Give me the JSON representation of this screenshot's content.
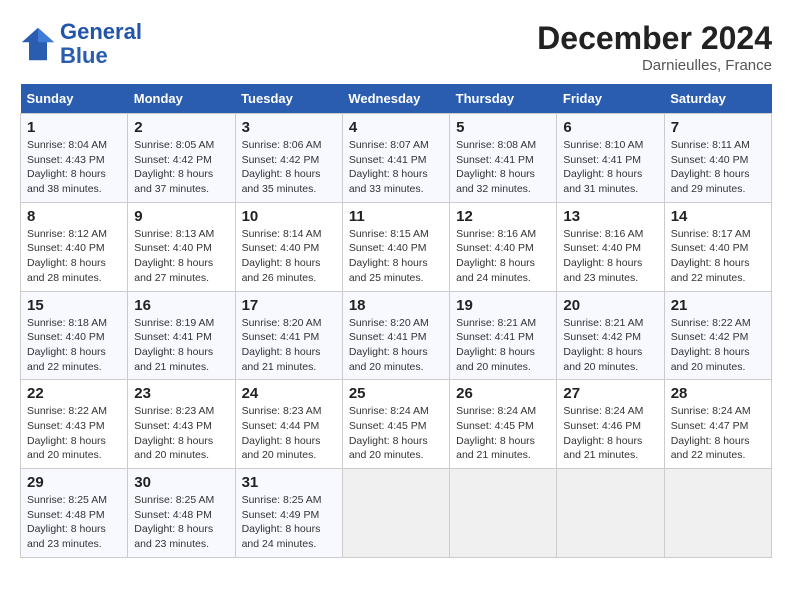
{
  "header": {
    "logo_line1": "General",
    "logo_line2": "Blue",
    "month_title": "December 2024",
    "location": "Darnieulles, France"
  },
  "weekdays": [
    "Sunday",
    "Monday",
    "Tuesday",
    "Wednesday",
    "Thursday",
    "Friday",
    "Saturday"
  ],
  "weeks": [
    [
      {
        "day": "1",
        "sunrise": "Sunrise: 8:04 AM",
        "sunset": "Sunset: 4:43 PM",
        "daylight": "Daylight: 8 hours and 38 minutes."
      },
      {
        "day": "2",
        "sunrise": "Sunrise: 8:05 AM",
        "sunset": "Sunset: 4:42 PM",
        "daylight": "Daylight: 8 hours and 37 minutes."
      },
      {
        "day": "3",
        "sunrise": "Sunrise: 8:06 AM",
        "sunset": "Sunset: 4:42 PM",
        "daylight": "Daylight: 8 hours and 35 minutes."
      },
      {
        "day": "4",
        "sunrise": "Sunrise: 8:07 AM",
        "sunset": "Sunset: 4:41 PM",
        "daylight": "Daylight: 8 hours and 33 minutes."
      },
      {
        "day": "5",
        "sunrise": "Sunrise: 8:08 AM",
        "sunset": "Sunset: 4:41 PM",
        "daylight": "Daylight: 8 hours and 32 minutes."
      },
      {
        "day": "6",
        "sunrise": "Sunrise: 8:10 AM",
        "sunset": "Sunset: 4:41 PM",
        "daylight": "Daylight: 8 hours and 31 minutes."
      },
      {
        "day": "7",
        "sunrise": "Sunrise: 8:11 AM",
        "sunset": "Sunset: 4:40 PM",
        "daylight": "Daylight: 8 hours and 29 minutes."
      }
    ],
    [
      {
        "day": "8",
        "sunrise": "Sunrise: 8:12 AM",
        "sunset": "Sunset: 4:40 PM",
        "daylight": "Daylight: 8 hours and 28 minutes."
      },
      {
        "day": "9",
        "sunrise": "Sunrise: 8:13 AM",
        "sunset": "Sunset: 4:40 PM",
        "daylight": "Daylight: 8 hours and 27 minutes."
      },
      {
        "day": "10",
        "sunrise": "Sunrise: 8:14 AM",
        "sunset": "Sunset: 4:40 PM",
        "daylight": "Daylight: 8 hours and 26 minutes."
      },
      {
        "day": "11",
        "sunrise": "Sunrise: 8:15 AM",
        "sunset": "Sunset: 4:40 PM",
        "daylight": "Daylight: 8 hours and 25 minutes."
      },
      {
        "day": "12",
        "sunrise": "Sunrise: 8:16 AM",
        "sunset": "Sunset: 4:40 PM",
        "daylight": "Daylight: 8 hours and 24 minutes."
      },
      {
        "day": "13",
        "sunrise": "Sunrise: 8:16 AM",
        "sunset": "Sunset: 4:40 PM",
        "daylight": "Daylight: 8 hours and 23 minutes."
      },
      {
        "day": "14",
        "sunrise": "Sunrise: 8:17 AM",
        "sunset": "Sunset: 4:40 PM",
        "daylight": "Daylight: 8 hours and 22 minutes."
      }
    ],
    [
      {
        "day": "15",
        "sunrise": "Sunrise: 8:18 AM",
        "sunset": "Sunset: 4:40 PM",
        "daylight": "Daylight: 8 hours and 22 minutes."
      },
      {
        "day": "16",
        "sunrise": "Sunrise: 8:19 AM",
        "sunset": "Sunset: 4:41 PM",
        "daylight": "Daylight: 8 hours and 21 minutes."
      },
      {
        "day": "17",
        "sunrise": "Sunrise: 8:20 AM",
        "sunset": "Sunset: 4:41 PM",
        "daylight": "Daylight: 8 hours and 21 minutes."
      },
      {
        "day": "18",
        "sunrise": "Sunrise: 8:20 AM",
        "sunset": "Sunset: 4:41 PM",
        "daylight": "Daylight: 8 hours and 20 minutes."
      },
      {
        "day": "19",
        "sunrise": "Sunrise: 8:21 AM",
        "sunset": "Sunset: 4:41 PM",
        "daylight": "Daylight: 8 hours and 20 minutes."
      },
      {
        "day": "20",
        "sunrise": "Sunrise: 8:21 AM",
        "sunset": "Sunset: 4:42 PM",
        "daylight": "Daylight: 8 hours and 20 minutes."
      },
      {
        "day": "21",
        "sunrise": "Sunrise: 8:22 AM",
        "sunset": "Sunset: 4:42 PM",
        "daylight": "Daylight: 8 hours and 20 minutes."
      }
    ],
    [
      {
        "day": "22",
        "sunrise": "Sunrise: 8:22 AM",
        "sunset": "Sunset: 4:43 PM",
        "daylight": "Daylight: 8 hours and 20 minutes."
      },
      {
        "day": "23",
        "sunrise": "Sunrise: 8:23 AM",
        "sunset": "Sunset: 4:43 PM",
        "daylight": "Daylight: 8 hours and 20 minutes."
      },
      {
        "day": "24",
        "sunrise": "Sunrise: 8:23 AM",
        "sunset": "Sunset: 4:44 PM",
        "daylight": "Daylight: 8 hours and 20 minutes."
      },
      {
        "day": "25",
        "sunrise": "Sunrise: 8:24 AM",
        "sunset": "Sunset: 4:45 PM",
        "daylight": "Daylight: 8 hours and 20 minutes."
      },
      {
        "day": "26",
        "sunrise": "Sunrise: 8:24 AM",
        "sunset": "Sunset: 4:45 PM",
        "daylight": "Daylight: 8 hours and 21 minutes."
      },
      {
        "day": "27",
        "sunrise": "Sunrise: 8:24 AM",
        "sunset": "Sunset: 4:46 PM",
        "daylight": "Daylight: 8 hours and 21 minutes."
      },
      {
        "day": "28",
        "sunrise": "Sunrise: 8:24 AM",
        "sunset": "Sunset: 4:47 PM",
        "daylight": "Daylight: 8 hours and 22 minutes."
      }
    ],
    [
      {
        "day": "29",
        "sunrise": "Sunrise: 8:25 AM",
        "sunset": "Sunset: 4:48 PM",
        "daylight": "Daylight: 8 hours and 23 minutes."
      },
      {
        "day": "30",
        "sunrise": "Sunrise: 8:25 AM",
        "sunset": "Sunset: 4:48 PM",
        "daylight": "Daylight: 8 hours and 23 minutes."
      },
      {
        "day": "31",
        "sunrise": "Sunrise: 8:25 AM",
        "sunset": "Sunset: 4:49 PM",
        "daylight": "Daylight: 8 hours and 24 minutes."
      },
      null,
      null,
      null,
      null
    ]
  ]
}
